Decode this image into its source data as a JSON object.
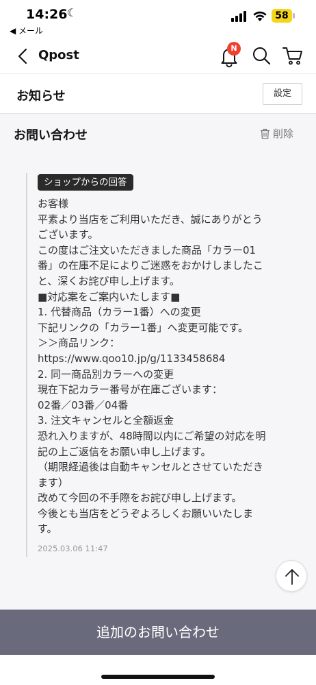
{
  "status_bar": {
    "time": "14:26",
    "back_app": "◀ メール",
    "battery": "58"
  },
  "header": {
    "title": "Qpost",
    "notification_badge": "N"
  },
  "notice": {
    "title": "お知らせ",
    "settings_label": "設定"
  },
  "inquiry": {
    "title": "お問い合わせ",
    "delete_label": "削除",
    "reply_badge": "ショップからの回答",
    "lines": [
      "お客様",
      "平素より当店をご利用いただき、誠にありがとう",
      "ございます。",
      "この度はご注文いただきました商品「カラー01",
      "番」の在庫不足によりご迷惑をおかけしましたこ",
      "と、深くお詫び申し上げます。",
      "■対応案をご案内いたします■",
      "1. 代替商品（カラー1番）への変更",
      "下記リンクの「カラー1番」へ変更可能です。",
      "＞＞商品リンク：",
      "https://www.qoo10.jp/g/1133458684",
      "2. 同一商品別カラーへの変更",
      "現在下記カラー番号が在庫ございます：",
      "02番／03番／04番",
      "3. 注文キャンセルと全額返金",
      "恐れ入りますが、48時間以内にご希望の対応を明",
      "記の上ご返信をお願い申し上げます。",
      "（期限経過後は自動キャンセルとさせていただき",
      "ます）",
      "改めて今回の不手際をお詫び申し上げます。",
      "今後とも当店をどうぞよろしくお願いいたしま",
      "す。"
    ],
    "date": "2025.03.06 11:47"
  },
  "footer": {
    "add_inquiry_label": "追加のお問い合わせ"
  },
  "colors": {
    "badge_red": "#f0402e",
    "battery_yellow": "#f5d51c",
    "bottom_button": "#6a6a7d"
  },
  "icons": [
    "moon-icon",
    "signal-icon",
    "wifi-icon",
    "battery-icon",
    "back-chevron-icon",
    "bell-icon",
    "search-icon",
    "cart-icon",
    "trash-icon",
    "arrow-up-icon"
  ]
}
